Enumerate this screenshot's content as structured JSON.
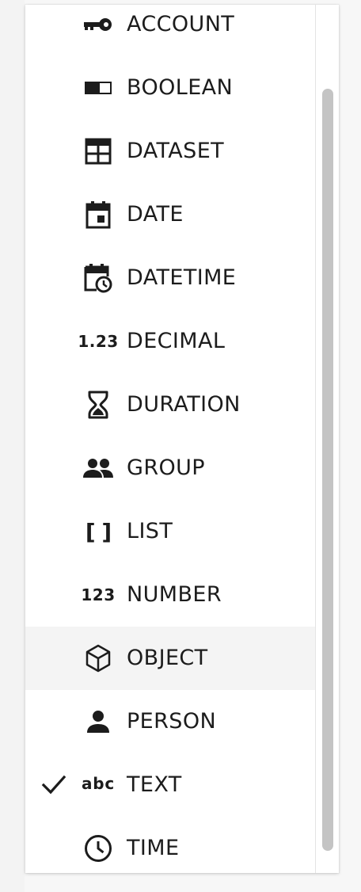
{
  "menu": {
    "items": [
      {
        "label": "ACCOUNT",
        "icon": "key-icon"
      },
      {
        "label": "BOOLEAN",
        "icon": "toggle-icon"
      },
      {
        "label": "DATASET",
        "icon": "table-icon"
      },
      {
        "label": "DATE",
        "icon": "calendar-icon"
      },
      {
        "label": "DATETIME",
        "icon": "calendar-clock-icon"
      },
      {
        "label": "DECIMAL",
        "icon": "decimal-icon",
        "glyph": "1.23"
      },
      {
        "label": "DURATION",
        "icon": "hourglass-icon"
      },
      {
        "label": "GROUP",
        "icon": "group-icon"
      },
      {
        "label": "LIST",
        "icon": "brackets-icon",
        "glyph": "[ ]"
      },
      {
        "label": "NUMBER",
        "icon": "number-icon",
        "glyph": "123"
      },
      {
        "label": "OBJECT",
        "icon": "cube-icon",
        "hovered": true
      },
      {
        "label": "PERSON",
        "icon": "person-icon"
      },
      {
        "label": "TEXT",
        "icon": "abc-icon",
        "glyph": "abc",
        "selected": true
      },
      {
        "label": "TIME",
        "icon": "clock-icon"
      }
    ],
    "selected_value": "TEXT"
  },
  "colors": {
    "text": "#1c1c1c",
    "hover_bg": "#f4f4f4",
    "scroll_thumb": "#c4c4c4"
  }
}
